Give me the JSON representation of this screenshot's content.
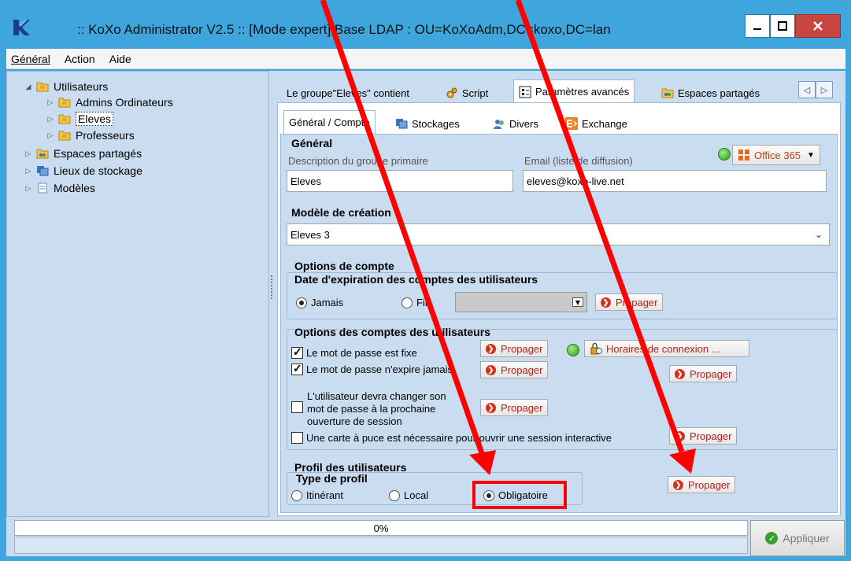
{
  "window": {
    "title": ":: KoXo Administrator V2.5 :: [Mode expert] Base LDAP : OU=KoXoAdm,DC=koxo,DC=lan",
    "minimize": "–",
    "maximize": "□",
    "close": "x"
  },
  "menu": [
    "Général",
    "Action",
    "Aide"
  ],
  "tree": {
    "root": "Utilisateurs",
    "children": [
      "Admins Ordinateurs",
      "Eleves",
      "Professeurs"
    ],
    "selected": "Eleves",
    "others": [
      "Espaces partagés",
      "Lieux de stockage",
      "Modèles"
    ]
  },
  "tabs": [
    "Le groupe\"Eleves\" contient",
    "Script",
    "Paramètres avancés",
    "Espaces partagés"
  ],
  "subtabs": [
    "Général / Compte",
    "Stockages",
    "Divers",
    "Exchange"
  ],
  "general": {
    "title": "Général",
    "desc_label": "Description du groupe primaire",
    "desc_value": "Eleves",
    "email_label": "Email (liste de diffusion)",
    "email_value": "eleves@koxo-live.net",
    "office_button": "Office 365"
  },
  "model": {
    "title": "Modèle de création",
    "value": "Eleves 3"
  },
  "account_options": {
    "title": "Options de compte",
    "expiry_title": "Date d'expiration des comptes des utilisateurs",
    "never": "Jamais",
    "end": "Fin",
    "propagate": "Propager"
  },
  "user_options": {
    "title": "Options des comptes des utilisateurs",
    "fixed_password": "Le mot de passe est fixe",
    "never_expires": "Le mot de passe n'expire jamais",
    "must_change": "L'utilisateur devra changer son\nmot de passe à la prochaine\nouverture de session",
    "must_change_lines": [
      "L'utilisateur devra changer son",
      "mot de passe à la prochaine",
      "ouverture de session"
    ],
    "smartcard": "Une carte à puce est nécessaire pour ouvrir une session interactive",
    "hours_button": "Horaires de connexion ...",
    "propagate": "Propager"
  },
  "profile": {
    "title": "Profil des utilisateurs",
    "type_title": "Type de profil",
    "roaming": "Itinérant",
    "local": "Local",
    "mandatory": "Obligatoire",
    "selected": "Obligatoire",
    "propagate": "Propager"
  },
  "status": {
    "progress": "0%",
    "apply": "Appliquer"
  },
  "colors": {
    "accent": "#3fa6dd",
    "panel": "#c9dcf0",
    "annotation": "#ff0000"
  }
}
